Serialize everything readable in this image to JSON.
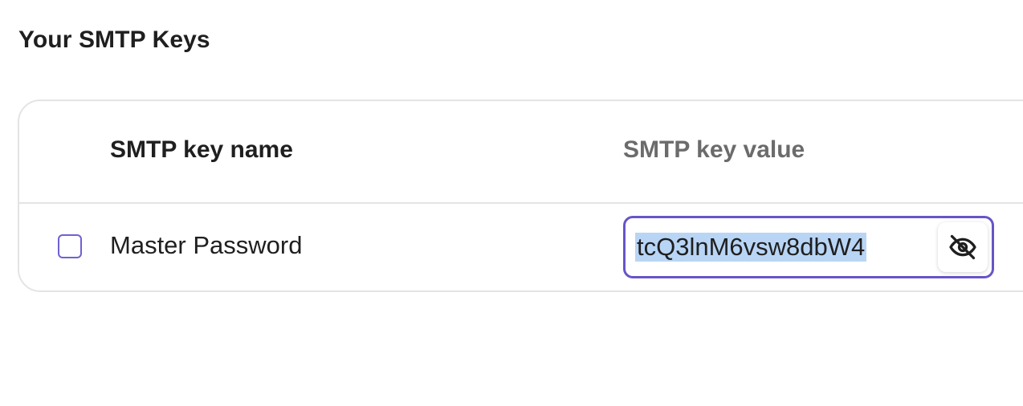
{
  "page": {
    "title": "Your SMTP Keys"
  },
  "table": {
    "headers": {
      "name": "SMTP key name",
      "value": "SMTP key value"
    },
    "rows": [
      {
        "name": "Master Password",
        "value": "tcQ3lnM6vsw8dbW4",
        "selected": false,
        "value_visible": true
      }
    ]
  },
  "icons": {
    "reveal_toggle": "eye-slash-icon"
  },
  "colors": {
    "accent": "#6655c8",
    "selection_highlight": "#b9d5f5",
    "border": "#e4e4e4"
  }
}
